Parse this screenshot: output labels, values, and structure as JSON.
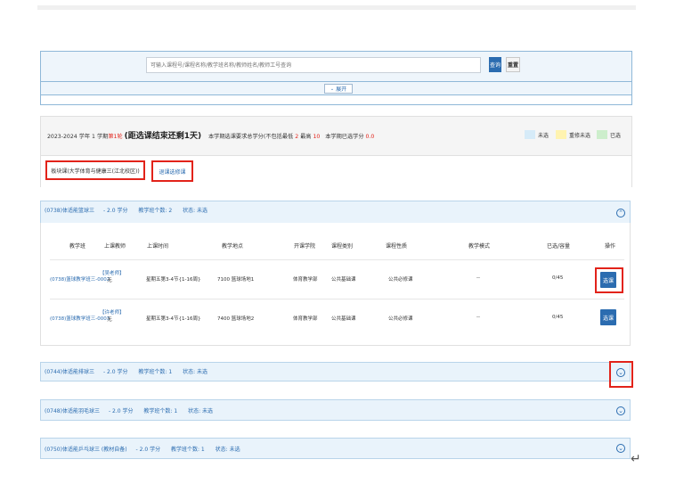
{
  "search": {
    "placeholder": "可输入课程号/课程名称/教学班名称/教师姓名/教师工号查询",
    "query_label": "查询",
    "reset_label": "重置",
    "expand_label": "展开",
    "expand_icon": "chevron-down-icon"
  },
  "info": {
    "term": "2023-2024 学年 1 学期",
    "round": "第1轮",
    "paren_open": "(",
    "countdown": "距选课结束还剩1天",
    "paren_close": ")",
    "req_label": "本学期选课要求总学分(不包括最低",
    "req_min": "2",
    "req_max_label": "最高",
    "req_max": "10",
    "earned_label": "本学期已选学分",
    "earned": "0.0",
    "legend": [
      {
        "label": "未选",
        "color": "#d6ebf8"
      },
      {
        "label": "重修未选",
        "color": "#fff3b0"
      },
      {
        "label": "已选",
        "color": "#cdeecc"
      }
    ]
  },
  "tabs": {
    "tab1": "板块课(大学体育与健康三(江北校区))",
    "tab2": "退课选修课"
  },
  "courses": [
    {
      "code": "(0738)体适能篮球三",
      "credit": "- 2.0 学分",
      "count": "教学班个数: 2",
      "status": "状态: 未选",
      "expanded": true
    },
    {
      "code": "(0744)体适能排球三",
      "credit": "- 2.0 学分",
      "count": "教学班个数: 1",
      "status": "状态: 未选",
      "expanded": false
    },
    {
      "code": "(0748)体适能羽毛球三",
      "credit": "- 2.0 学分",
      "count": "教学班个数: 1",
      "status": "状态: 未选",
      "expanded": false
    },
    {
      "code": "(0750)体适能乒乓球三 (教材自备)",
      "credit": "- 2.0 学分",
      "count": "教学班个数: 1",
      "status": "状态: 未选",
      "expanded": false
    }
  ],
  "table": {
    "headers": [
      "教学班",
      "上课教师",
      "上课时间",
      "教学地点",
      "开课学院",
      "课程类别",
      "课程性质",
      "教学模式",
      "已选/容量",
      "操作"
    ],
    "rows": [
      {
        "class": "(0738)篮球教学班三-0002",
        "teacher_badge": "【吴老师】",
        "teacher": "无",
        "time": "星期五第3-4节{1-16周}",
        "place": "7100 篮球场地1",
        "college": "体育教学部",
        "category": "公共基础课",
        "nature": "公共必修课",
        "mode": "--",
        "capacity": "0/45",
        "action": "选课"
      },
      {
        "class": "(0738)篮球教学班三-0003",
        "teacher_badge": "【许老师】",
        "teacher": "无",
        "time": "星期五第3-4节{1-16周}",
        "place": "7400 篮球场地2",
        "college": "体育教学部",
        "category": "公共基础课",
        "nature": "公共必修课",
        "mode": "--",
        "capacity": "0/45",
        "action": "选课"
      }
    ]
  },
  "return_mark": "↵"
}
